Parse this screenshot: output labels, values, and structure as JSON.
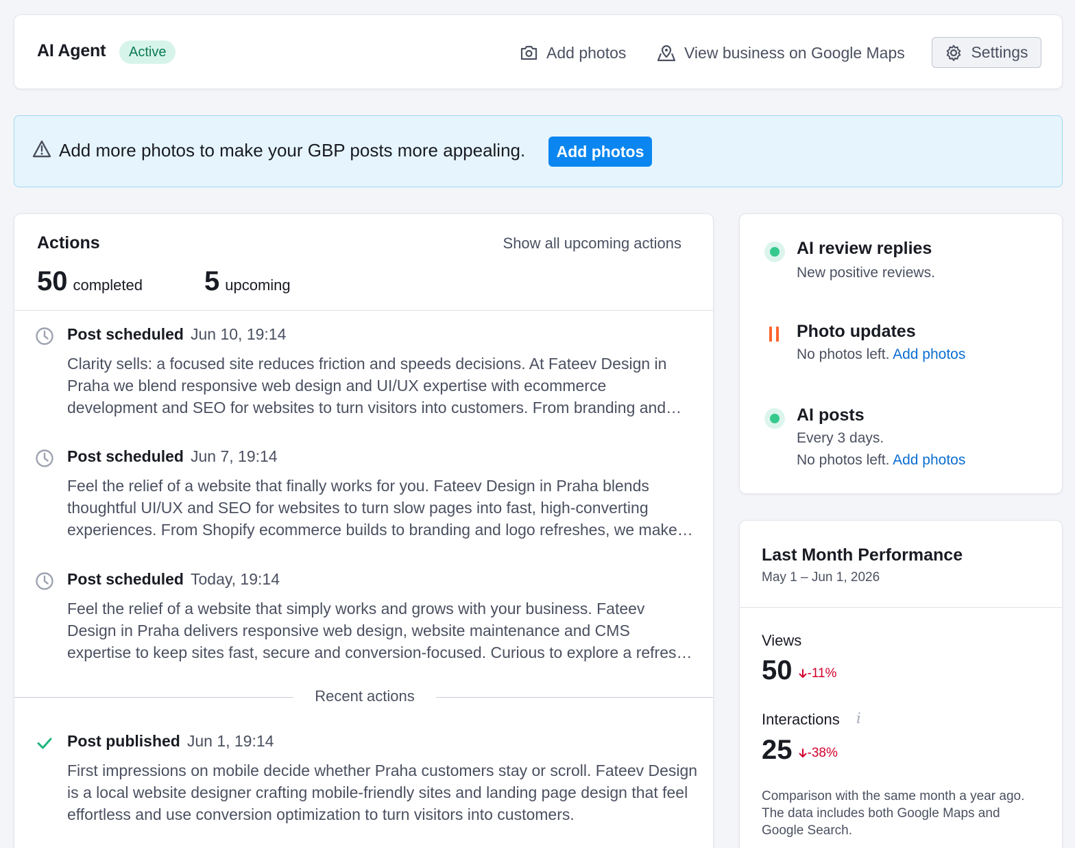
{
  "header": {
    "title": "AI Agent",
    "status": "Active",
    "add_photos": "Add photos",
    "view_maps": "View business on Google Maps",
    "settings": "Settings"
  },
  "banner": {
    "message": "Add more photos to make your GBP posts more appealing.",
    "button": "Add photos"
  },
  "actions": {
    "title": "Actions",
    "show_all": "Show all upcoming actions",
    "completed_count": "50",
    "completed_label": "completed",
    "upcoming_count": "5",
    "upcoming_label": "upcoming",
    "recent_label": "Recent actions",
    "items": [
      {
        "kind": "Post scheduled",
        "date": "Jun 10, 19:14",
        "icon": "clock-icon",
        "text": "Clarity sells: a focused site reduces friction and speeds decisions. At Fateev Design in Praha we blend responsive web design and UI/UX expertise with ecommerce development and SEO for websites to turn visitors into customers. From branding and logo refreshes to website maintenance, we keep your site fast and focused."
      },
      {
        "kind": "Post scheduled",
        "date": "Jun 7, 19:14",
        "icon": "clock-icon",
        "text": "Feel the relief of a website that finally works for you. Fateev Design in Praha blends thoughtful UI/UX and SEO for websites to turn slow pages into fast, high-converting experiences. From Shopify ecommerce builds to branding and logo refreshes, we make every page count for your business."
      },
      {
        "kind": "Post scheduled",
        "date": "Today, 19:14",
        "icon": "clock-icon",
        "text": "Feel the relief of a website that simply works and grows with your business. Fateev Design in Praha delivers responsive web design, website maintenance and CMS expertise to keep sites fast, secure and conversion-focused. Curious to explore a refresh for your site?"
      },
      {
        "kind": "Post published",
        "date": "Jun 1, 19:14",
        "icon": "check-icon",
        "text": "First impressions on mobile decide whether Praha customers stay or scroll. Fateev Design is a local website designer crafting mobile-friendly sites and landing page design that feel effortless and use conversion optimization to turn visitors into customers."
      }
    ]
  },
  "status_panel": {
    "items": [
      {
        "title": "AI review replies",
        "line1": "New positive reviews.",
        "line2": "",
        "link": "",
        "indicator": "active"
      },
      {
        "title": "Photo updates",
        "line1": "No photos left.",
        "line2": "",
        "link": "Add photos",
        "indicator": "paused"
      },
      {
        "title": "AI posts",
        "line1": "Every 3 days.",
        "line2": "No photos left.",
        "link": "Add photos",
        "indicator": "active"
      }
    ]
  },
  "performance": {
    "title": "Last Month Performance",
    "range": "May 1 – Jun 1, 2026",
    "views_label": "Views",
    "views_value": "50",
    "views_delta": "-11%",
    "interactions_label": "Interactions",
    "interactions_value": "25",
    "interactions_delta": "-38%",
    "note": "Comparison with the same month a year ago. The data includes both Google Maps and Google Search."
  },
  "colors": {
    "accent": "#0b86f0",
    "link": "#0a6ed1",
    "active_green": "#35c98d",
    "paused_orange": "#ff642d",
    "negative_red": "#d1002b"
  }
}
